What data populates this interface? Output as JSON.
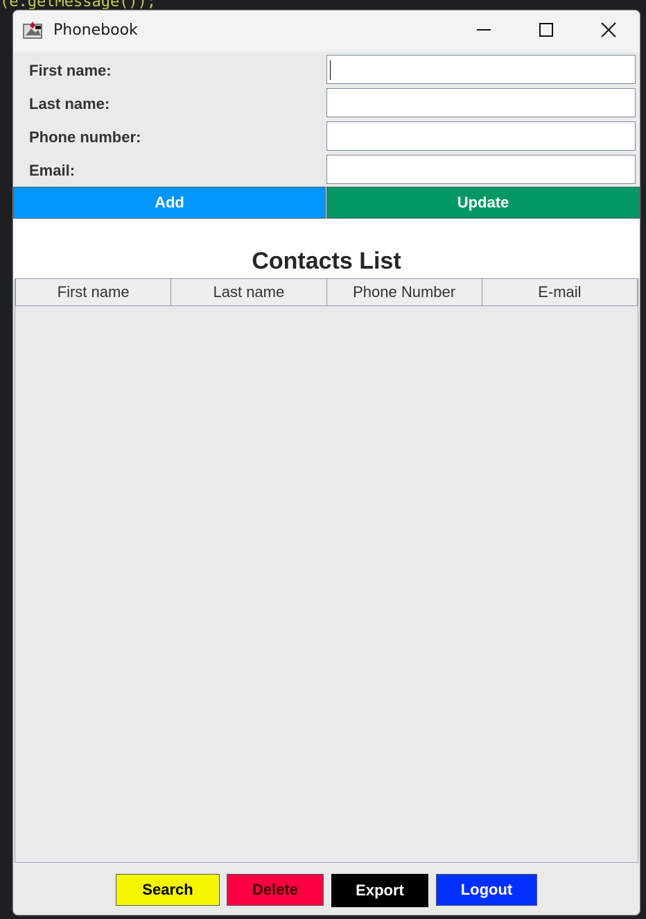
{
  "window": {
    "title": "Phonebook",
    "icon": "java-app-icon"
  },
  "window_controls": {
    "minimize_icon": "minimize-icon",
    "maximize_icon": "maximize-icon",
    "close_icon": "close-icon"
  },
  "form": {
    "fields": [
      {
        "label": "First name:",
        "value": ""
      },
      {
        "label": "Last name:",
        "value": ""
      },
      {
        "label": "Phone number:",
        "value": ""
      },
      {
        "label": "Email:",
        "value": ""
      }
    ]
  },
  "actions": {
    "add_label": "Add",
    "update_label": "Update",
    "add_color": "#0096ff",
    "update_color": "#019866"
  },
  "contacts": {
    "title": "Contacts List",
    "columns": [
      "First name",
      "Last name",
      "Phone Number",
      "E-mail"
    ],
    "rows": []
  },
  "bottom": {
    "search_label": "Search",
    "delete_label": "Delete",
    "export_label": "Export",
    "logout_label": "Logout",
    "search_color": "#f5f500",
    "delete_color": "#ff0040",
    "export_color": "#000000",
    "logout_color": "#0030ff"
  }
}
